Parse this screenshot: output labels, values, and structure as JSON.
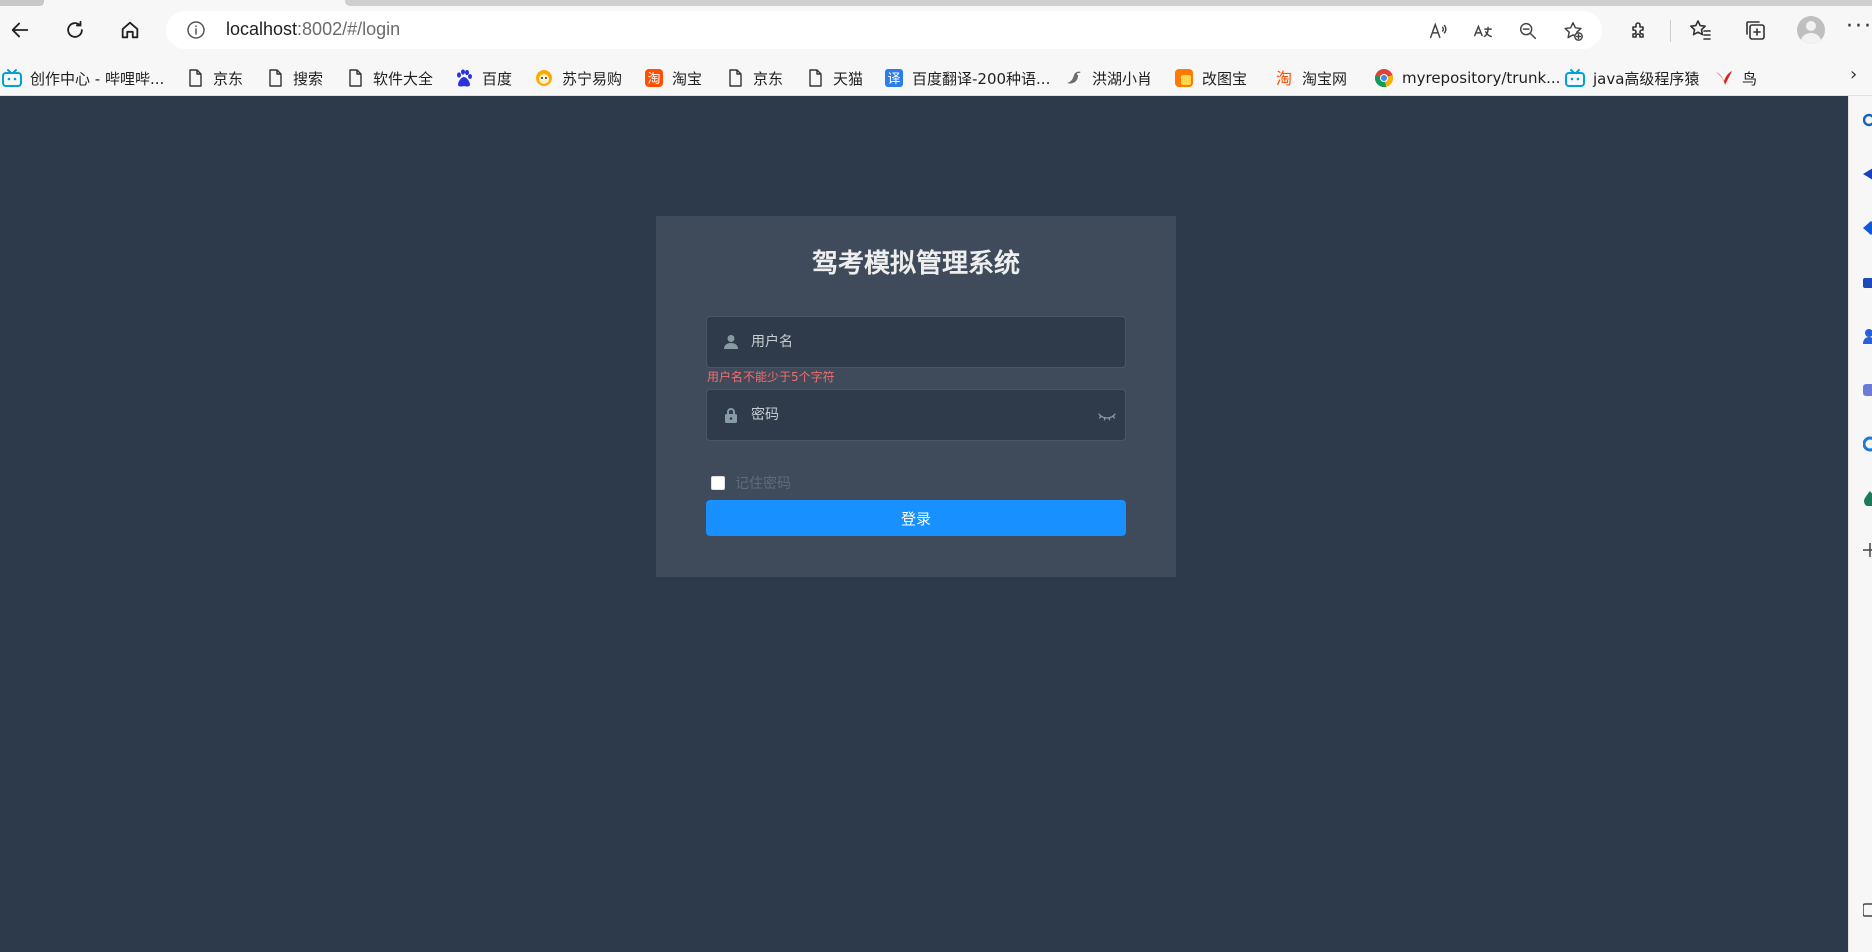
{
  "browser": {
    "url_host": "localhost",
    "url_path": ":8002/#/login",
    "icons": [
      "back-icon",
      "refresh-icon",
      "home-icon",
      "info-icon",
      "read-aloud-icon",
      "translate-icon",
      "zoom-out-icon",
      "add-favorite-icon",
      "extensions-icon",
      "favorites-icon",
      "collections-icon",
      "profile-icon",
      "more-icon"
    ],
    "more_label": "···"
  },
  "bookmarks": [
    {
      "label": "创作中心 - 哔哩哔...",
      "icon": "bilibili-icon",
      "color": "#00a1d6"
    },
    {
      "label": "京东",
      "icon": "page-icon"
    },
    {
      "label": "搜索",
      "icon": "page-icon"
    },
    {
      "label": "软件大全",
      "icon": "page-icon"
    },
    {
      "label": "百度",
      "icon": "baidu-icon",
      "color": "#2932e1"
    },
    {
      "label": "苏宁易购",
      "icon": "suning-icon",
      "color": "#ffaa00"
    },
    {
      "label": "淘宝",
      "icon": "taobao-icon",
      "color": "#ff5000"
    },
    {
      "label": "京东",
      "icon": "page-icon"
    },
    {
      "label": "天猫",
      "icon": "page-icon"
    },
    {
      "label": "百度翻译-200种语...",
      "icon": "translate-icon",
      "color": "#2b7de9",
      "glyph": "译"
    },
    {
      "label": "洪湖小肖",
      "icon": "bird-icon"
    },
    {
      "label": "改图宝",
      "icon": "gaitubao-icon",
      "color": "#ff7a00"
    },
    {
      "label": "淘宝网",
      "icon": "taobao-icon",
      "color": "#ff5000",
      "glyph": "淘"
    },
    {
      "label": "myrepository/trunk...",
      "icon": "chrome-icon"
    },
    {
      "label": "java高级程序猿",
      "icon": "bilibili-icon",
      "color": "#00a1d6"
    },
    {
      "label": "鸟",
      "icon": "swallow-icon",
      "color": "#e02020"
    }
  ],
  "bookmarks_more": "›",
  "login": {
    "title": "驾考模拟管理系统",
    "username_placeholder": "用户名",
    "username_error": "用户名不能少于5个字符",
    "password_placeholder": "密码",
    "remember_label": "记住密码",
    "submit_label": "登录"
  },
  "colors": {
    "page_bg": "#2d3a4b",
    "card_bg": "#3f4b5b",
    "primary": "#1890ff",
    "error": "#f56c6c"
  }
}
